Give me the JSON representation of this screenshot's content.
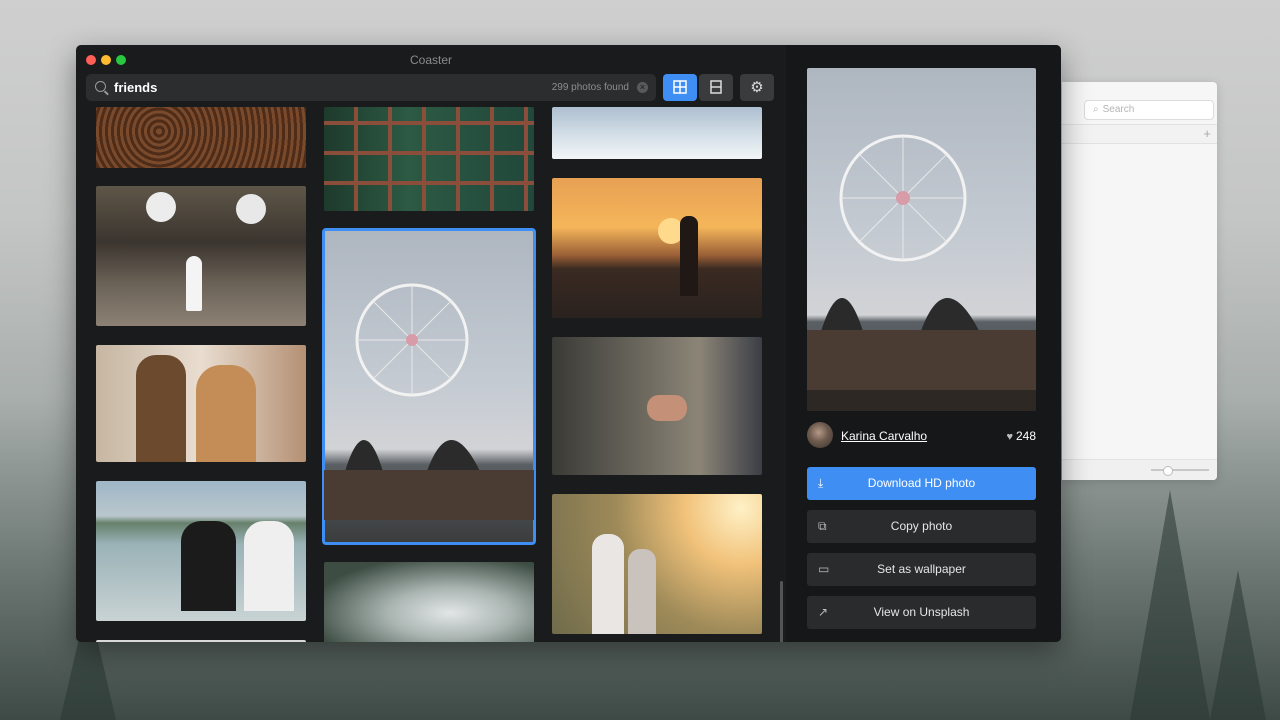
{
  "background_window": {
    "search_placeholder": "Search",
    "plus_symbol": "+"
  },
  "window": {
    "title": "Coaster",
    "traffic_lights": [
      "#ff5f57",
      "#febc2e",
      "#28c840"
    ]
  },
  "search": {
    "query": "friends",
    "result_count": "299 photos found",
    "clear_symbol": "×"
  },
  "toolbar": {
    "grid_view_icon": "grid-view-icon",
    "list_view_icon": "list-view-icon",
    "settings_icon": "gear-icon",
    "active_color": "#3f8ef3"
  },
  "photos": [
    {
      "id": "photo-coffee-beans",
      "subject": "coffee-beans"
    },
    {
      "id": "photo-wedding-balloons",
      "subject": "wedding"
    },
    {
      "id": "photo-two-friends-hats",
      "subject": "two-women"
    },
    {
      "id": "photo-friends-camera-beach",
      "subject": "beach-camera"
    },
    {
      "id": "photo-green-window",
      "subject": "window"
    },
    {
      "id": "photo-ferris-wheel-selected",
      "subject": "ferris-wheel",
      "selected": true
    },
    {
      "id": "photo-clouds-aerial",
      "subject": "clouds"
    },
    {
      "id": "photo-snow-feet",
      "subject": "snow"
    },
    {
      "id": "photo-sunset-silhouettes",
      "subject": "sunset"
    },
    {
      "id": "photo-helping-hand",
      "subject": "hands"
    },
    {
      "id": "photo-girls-sunlight",
      "subject": "girls"
    }
  ],
  "detail": {
    "author": "Karina Carvalho",
    "likes": "248",
    "heart_icon": "♥",
    "actions": [
      {
        "label": "Download HD photo",
        "icon": "download-icon",
        "glyph": "⤓",
        "primary": true
      },
      {
        "label": "Copy photo",
        "icon": "copy-icon",
        "glyph": "⧉",
        "primary": false
      },
      {
        "label": "Set as wallpaper",
        "icon": "monitor-icon",
        "glyph": "▭",
        "primary": false
      },
      {
        "label": "View on Unsplash",
        "icon": "external-link-icon",
        "glyph": "↗",
        "primary": false
      }
    ]
  }
}
